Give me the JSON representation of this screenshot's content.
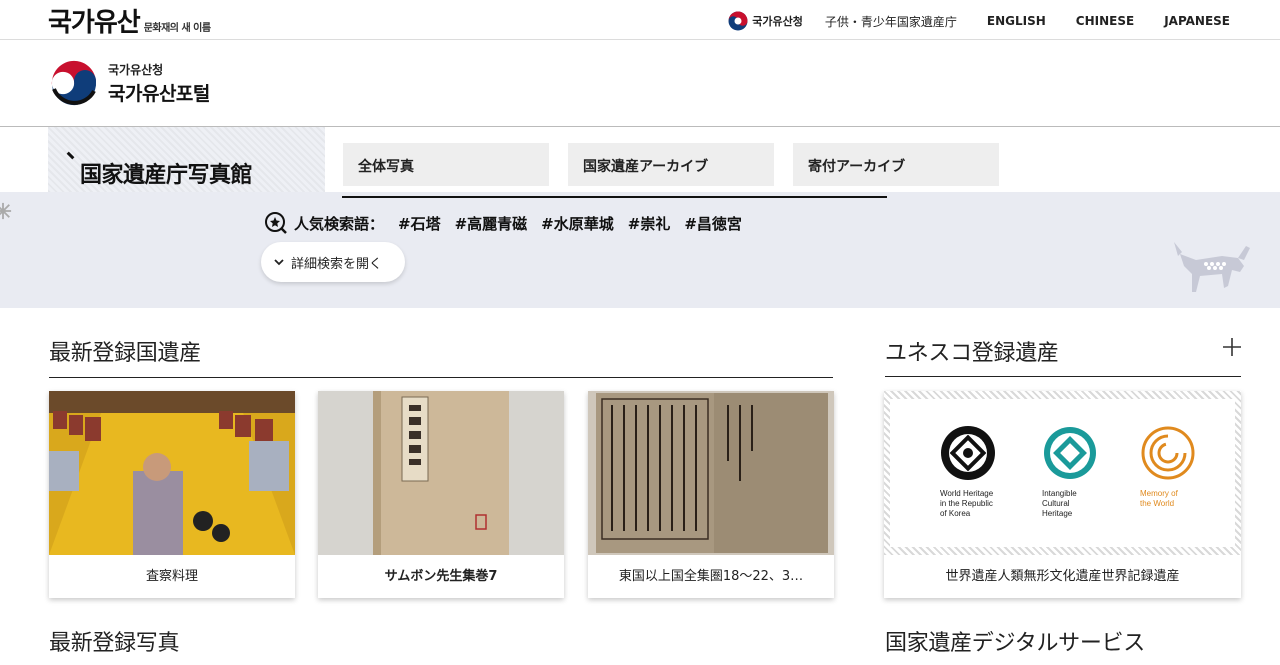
{
  "topbar": {
    "brand_main": "국가유산",
    "brand_sub": "문화재의 새 이름",
    "agency_link": "국가유산청",
    "links": [
      "子供・青少年国家遺産庁",
      "ENGLISH",
      "CHINESE",
      "JAPANESE"
    ]
  },
  "header": {
    "agency": "국가유산청",
    "portal": "국가유산포털"
  },
  "gallery": {
    "title": "国家遺産庁写真館"
  },
  "menu": {
    "tabs": [
      "全体写真",
      "国家遺産アーカイブ",
      "寄付アーカイブ"
    ]
  },
  "search": {
    "popular_label": "人気検索語：",
    "tags": [
      "#石塔",
      "#高麗青磁",
      "#水原華城",
      "#崇礼",
      "#昌徳宮"
    ],
    "advanced_label": "詳細検索を開く"
  },
  "sections": {
    "latest_heritage": "最新登録国遺産",
    "unesco": "ユネスコ登録遺産",
    "latest_photos": "最新登録写真",
    "digital_services": "国家遺産デジタルサービス"
  },
  "cards": [
    {
      "caption": "査察料理"
    },
    {
      "caption": "サムボン先生集巻7"
    },
    {
      "caption": "東国以上国全集圏18〜22、3…"
    }
  ],
  "unesco": {
    "logos": [
      {
        "label": "World Heritage in the Republic of Korea",
        "lines": [
          "World Heritage",
          "in the Republic",
          "of Korea"
        ],
        "color": "#111111"
      },
      {
        "label": "Intangible Cultural Heritage",
        "lines": [
          "Intangible",
          "Cultural",
          "Heritage"
        ],
        "color": "#1a9a9a"
      },
      {
        "label": "Memory of the World",
        "lines": [
          "Memory of",
          "the World"
        ],
        "color": "#e08a1e"
      }
    ],
    "caption": "世界遺産人類無形文化遺産世界記録遺産"
  },
  "colors": {
    "band": "#e9ebf2",
    "tab": "#eeeeee",
    "taeguk_red": "#c8102e",
    "taeguk_blue": "#0f3d7a"
  }
}
